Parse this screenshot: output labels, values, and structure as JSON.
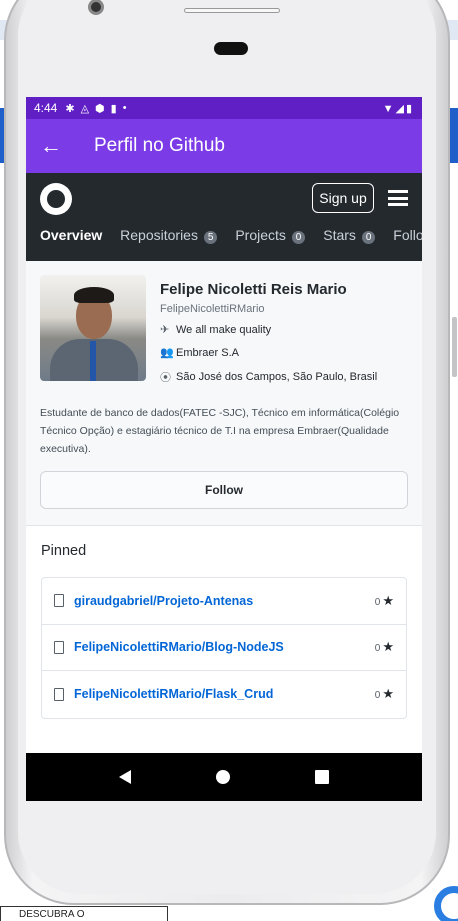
{
  "background": {
    "bottom_box_text": "DESCUBRA O"
  },
  "statusbar": {
    "time": "4:44",
    "icons": [
      "gear-icon",
      "a-icon",
      "shield-icon",
      "sd-card-icon",
      "dot-icon"
    ],
    "right_icons": [
      "wifi-icon",
      "signal-icon",
      "battery-icon"
    ]
  },
  "appbar": {
    "back_icon": "arrow-left-icon",
    "title": "Perfil no Github"
  },
  "github": {
    "signup_label": "Sign up",
    "tabs": [
      {
        "label": "Overview",
        "count": null
      },
      {
        "label": "Repositories",
        "count": "5"
      },
      {
        "label": "Projects",
        "count": "0"
      },
      {
        "label": "Stars",
        "count": "0"
      },
      {
        "label": "Follow",
        "count": null
      }
    ]
  },
  "profile": {
    "name": "Felipe Nicoletti Reis Mario",
    "login": "FelipeNicolettiRMario",
    "tagline": "We all make quality",
    "company": "Embraer S.A",
    "location": "São José dos Campos, São Paulo, Brasil",
    "bio": "Estudante de banco de dados(FATEC -SJC), Técnico em informática(Colégio Técnico Opção) e estagiário técnico de T.I na empresa Embraer(Qualidade executiva).",
    "follow_label": "Follow"
  },
  "pinned": {
    "title": "Pinned",
    "repos": [
      {
        "name": "giraudgabriel/Projeto-Antenas",
        "stars": "0"
      },
      {
        "name": "FelipeNicolettiRMario/Blog-NodeJS",
        "stars": "0"
      },
      {
        "name": "FelipeNicolettiRMario/Flask_Crud",
        "stars": "0"
      }
    ]
  },
  "colors": {
    "statusbar": "#5f1fc4",
    "appbar": "#7b3be6",
    "github_header": "#24292e",
    "link": "#0366d6"
  }
}
